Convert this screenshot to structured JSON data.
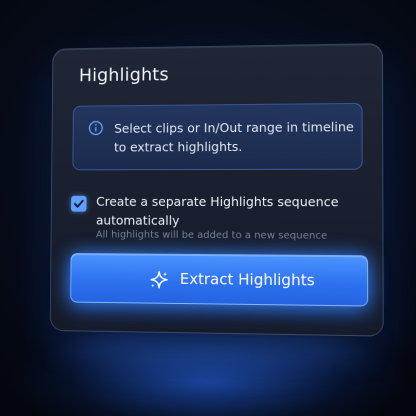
{
  "panel": {
    "title": "Highlights"
  },
  "info": {
    "icon": "info-icon",
    "text": "Select clips or In/Out range in timeline to extract highlights."
  },
  "option": {
    "checked": true,
    "label": "Create a separate Highlights sequence automatically",
    "sublabel": "All highlights will be added to a new sequence"
  },
  "action": {
    "icon": "sparkle-icon",
    "label": "Extract Highlights"
  },
  "colors": {
    "accent": "#2d72f0",
    "checkbox": "#5ea0ff",
    "panel_bg": "#1a2030"
  }
}
